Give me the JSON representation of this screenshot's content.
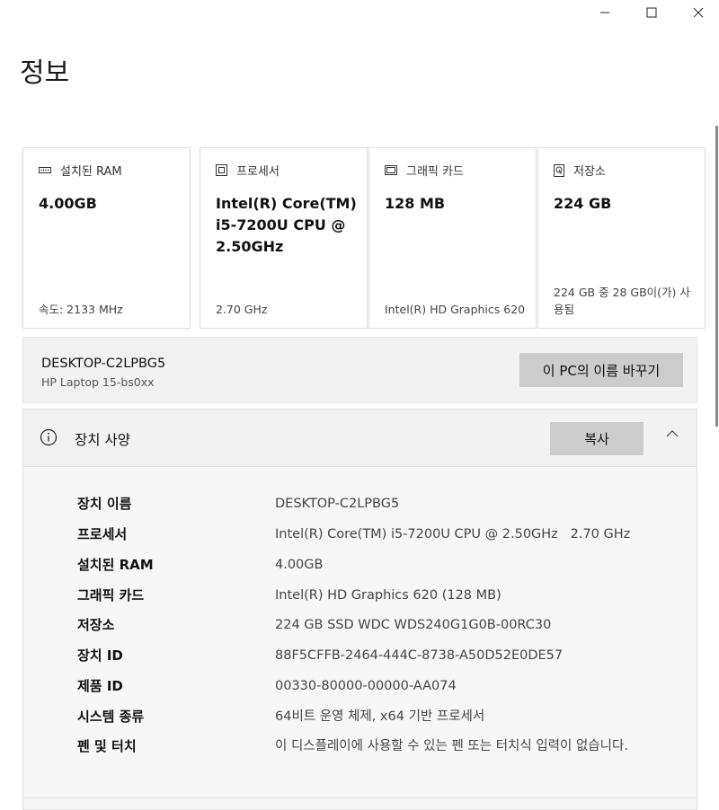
{
  "window": {
    "minimize_icon": "minimize-icon",
    "maximize_icon": "maximize-icon",
    "close_icon": "close-icon"
  },
  "page": {
    "title": "정보"
  },
  "cards": [
    {
      "icon": "ram-icon",
      "label": "설치된 RAM",
      "value": "4.00GB",
      "footer": "속도: 2133 MHz"
    },
    {
      "icon": "processor-icon",
      "label": "프로세서",
      "value": "Intel(R) Core(TM) i5-7200U CPU @ 2.50GHz",
      "footer": "2.70 GHz"
    },
    {
      "icon": "graphics-card-icon",
      "label": "그래픽 카드",
      "value": "128 MB",
      "footer": "Intel(R) HD Graphics 620"
    },
    {
      "icon": "storage-icon",
      "label": "저장소",
      "value": "224 GB",
      "footer": "224 GB 중 28 GB이(가) 사용됨"
    }
  ],
  "pc": {
    "name": "DESKTOP-C2LPBG5",
    "model": "HP Laptop 15-bs0xx",
    "rename_label": "이 PC의 이름 바꾸기"
  },
  "specs": {
    "title": "장치 사양",
    "copy_label": "복사",
    "rows": [
      {
        "label": "장치 이름",
        "value": "DESKTOP-C2LPBG5"
      },
      {
        "label": "프로세서",
        "value": "Intel(R) Core(TM) i5-7200U CPU @ 2.50GHz   2.70 GHz"
      },
      {
        "label": "설치된 RAM",
        "value": "4.00GB"
      },
      {
        "label": "그래픽 카드",
        "value": "Intel(R) HD Graphics 620 (128 MB)"
      },
      {
        "label": "저장소",
        "value": "224 GB SSD WDC WDS240G1G0B-00RC30"
      },
      {
        "label": "장치 ID",
        "value": "88F5CFFB-2464-444C-8738-A50D52E0DE57"
      },
      {
        "label": "제품 ID",
        "value": "00330-80000-00000-AA074"
      },
      {
        "label": "시스템 종류",
        "value": "64비트 운영 체제, x64 기반 프로세서"
      },
      {
        "label": "펜 및 터치",
        "value": "이 디스플레이에 사용할 수 있는 펜 또는 터치식 입력이 없습니다."
      }
    ]
  }
}
